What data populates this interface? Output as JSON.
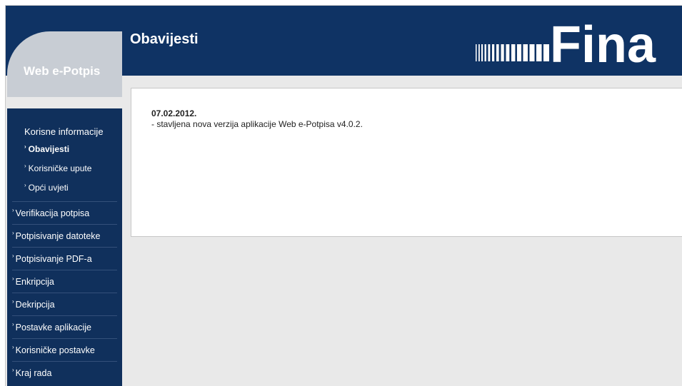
{
  "app": {
    "title": "Web e-Potpis"
  },
  "header": {
    "page_title": "Obavijesti",
    "brand": "Fina"
  },
  "sidebar": {
    "group_title": "Korisne informacije",
    "sub_items": [
      {
        "label": "Obavijesti",
        "active": true
      },
      {
        "label": "Korisničke upute",
        "active": false
      },
      {
        "label": "Opći uvjeti",
        "active": false
      }
    ],
    "items": [
      {
        "label": "Verifikacija potpisa"
      },
      {
        "label": "Potpisivanje datoteke"
      },
      {
        "label": "Potpisivanje PDF-a"
      },
      {
        "label": "Enkripcija"
      },
      {
        "label": "Dekripcija"
      },
      {
        "label": "Postavke aplikacije"
      },
      {
        "label": "Korisničke postavke"
      },
      {
        "label": "Kraj rada"
      }
    ]
  },
  "news": {
    "date": "07.02.2012.",
    "text": "- stavljena nova verzija aplikacije Web e-Potpisa v4.0.2."
  },
  "colors": {
    "header_bg": "#0f3364",
    "sidebar_bg": "#10305c",
    "logo_tab_bg": "#c8cdd4",
    "page_bg": "#e9e9e9"
  }
}
